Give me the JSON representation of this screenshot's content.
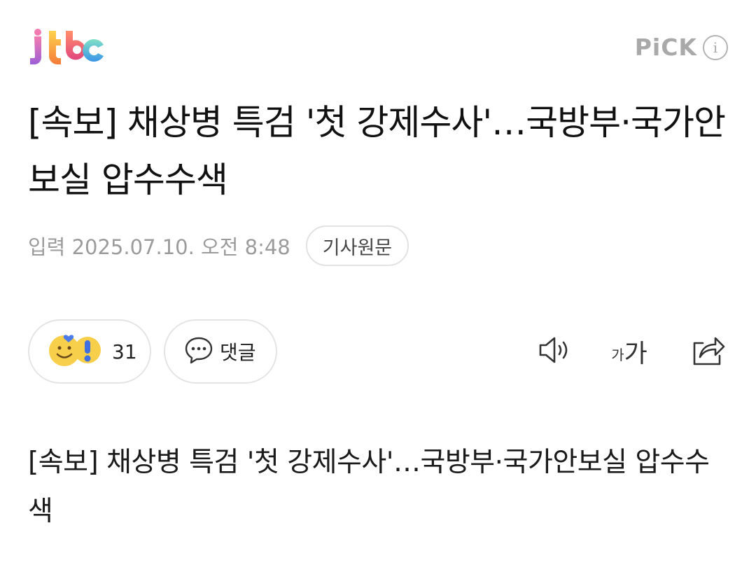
{
  "header": {
    "logo_text": "jtbc",
    "pick_label": "PiCK",
    "info_icon": "info-icon"
  },
  "article": {
    "title": "[속보] 채상병 특검 '첫 강제수사'…국방부·국가안보실 압수수색",
    "date": "입력 2025.07.10. 오전 8:48",
    "original_button": "기사원문",
    "body": "[속보] 채상병 특검 '첫 강제수사'…국방부·국가안보실 압수수색"
  },
  "actions": {
    "reaction_count": "31",
    "comment_label": "댓글",
    "font_small": "가",
    "font_large": "가",
    "icons": [
      "reaction-emoji-icon",
      "comment-bubble-icon",
      "speaker-icon",
      "font-size-icon",
      "share-icon"
    ]
  },
  "colors": {
    "logo_j": "#c86bd4",
    "logo_t": "#f58a3b",
    "logo_b": "#e94f7c",
    "logo_c": "#4bb0e6",
    "muted": "#9b9b9b",
    "border": "#e4e4e4"
  }
}
